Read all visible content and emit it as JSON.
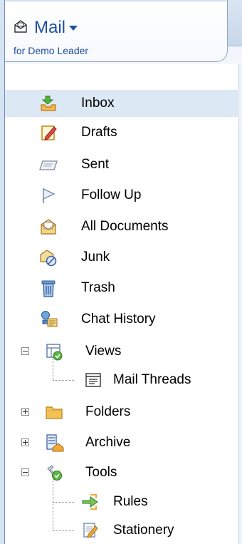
{
  "header": {
    "app_title": "Mail",
    "subtitle": "for Demo Leader",
    "app_icon": "mail-app-icon",
    "dropdown_icon": "chevron-down-icon"
  },
  "nav": {
    "items": [
      {
        "label": "Inbox",
        "icon": "inbox-icon",
        "selected": true
      },
      {
        "label": "Drafts",
        "icon": "drafts-icon"
      },
      {
        "label": "Sent",
        "icon": "sent-icon"
      },
      {
        "label": "Follow Up",
        "icon": "follow-up-flag-icon"
      },
      {
        "label": "All Documents",
        "icon": "all-documents-icon"
      },
      {
        "label": "Junk",
        "icon": "junk-icon"
      },
      {
        "label": "Trash",
        "icon": "trash-icon"
      },
      {
        "label": "Chat History",
        "icon": "chat-history-icon"
      },
      {
        "label": "Views",
        "icon": "views-icon",
        "expanded": true,
        "children": [
          {
            "label": "Mail Threads",
            "icon": "mail-threads-icon"
          }
        ]
      },
      {
        "label": "Folders",
        "icon": "folder-icon",
        "expanded": false
      },
      {
        "label": "Archive",
        "icon": "archive-icon",
        "expanded": false
      },
      {
        "label": "Tools",
        "icon": "tools-icon",
        "expanded": true,
        "children": [
          {
            "label": "Rules",
            "icon": "rules-icon"
          },
          {
            "label": "Stationery",
            "icon": "stationery-icon"
          }
        ]
      }
    ]
  },
  "colors": {
    "accent": "#1f4fa0",
    "selected_row": "#dde8f5",
    "frame": "#6d8fba"
  }
}
